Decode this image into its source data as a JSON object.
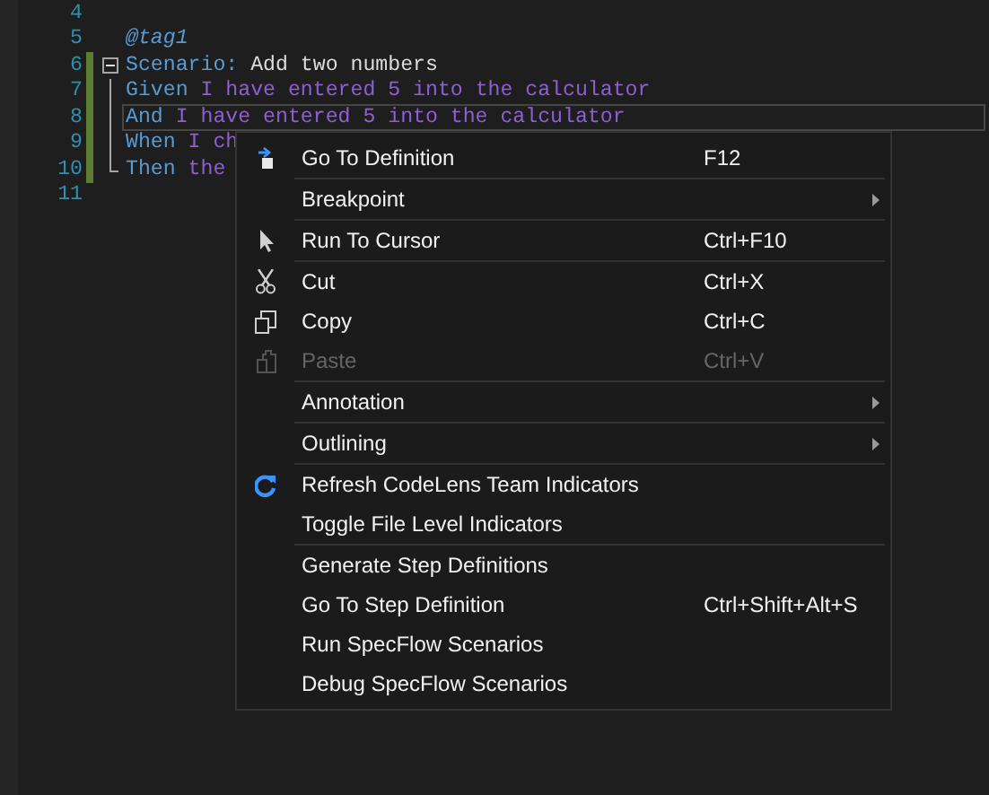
{
  "editor": {
    "lines": [
      {
        "number": "4"
      },
      {
        "number": "5",
        "tokens": [
          {
            "kind": "tag",
            "text": "@tag1"
          }
        ]
      },
      {
        "number": "6",
        "changed": true,
        "expanded": true,
        "tokens": [
          {
            "kind": "keyword",
            "text": "Scenario:"
          },
          {
            "kind": "plain",
            "text": " Add two numbers"
          }
        ]
      },
      {
        "number": "7",
        "changed": true,
        "tokens": [
          {
            "kind": "keyword",
            "text": "Given"
          },
          {
            "kind": "step",
            "text": " I have entered 5 into the calculator"
          }
        ]
      },
      {
        "number": "8",
        "changed": true,
        "current": true,
        "tokens": [
          {
            "kind": "keyword",
            "text": "And"
          },
          {
            "kind": "step",
            "text": " I have entered 5 into the calculator"
          }
        ]
      },
      {
        "number": "9",
        "changed": true,
        "tokens": [
          {
            "kind": "keyword",
            "text": "When"
          },
          {
            "kind": "step",
            "text": " I ch"
          }
        ]
      },
      {
        "number": "10",
        "changed": true,
        "tokens": [
          {
            "kind": "keyword",
            "text": "Then"
          },
          {
            "kind": "step",
            "text": " the"
          }
        ]
      },
      {
        "number": "11"
      }
    ]
  },
  "context_menu": {
    "items": [
      {
        "kind": "item",
        "label": "Go To Definition",
        "shortcut": "F12"
      },
      {
        "kind": "separator"
      },
      {
        "kind": "item",
        "label": "Breakpoint",
        "submenu": true
      },
      {
        "kind": "separator"
      },
      {
        "kind": "item",
        "label": "Run To Cursor",
        "shortcut": "Ctrl+F10"
      },
      {
        "kind": "separator"
      },
      {
        "kind": "item",
        "label": "Cut",
        "shortcut": "Ctrl+X"
      },
      {
        "kind": "item",
        "label": "Copy",
        "shortcut": "Ctrl+C"
      },
      {
        "kind": "item",
        "label": "Paste",
        "shortcut": "Ctrl+V",
        "disabled": true
      },
      {
        "kind": "separator"
      },
      {
        "kind": "item",
        "label": "Annotation",
        "submenu": true
      },
      {
        "kind": "separator"
      },
      {
        "kind": "item",
        "label": "Outlining",
        "submenu": true
      },
      {
        "kind": "separator"
      },
      {
        "kind": "item",
        "label": "Refresh CodeLens Team Indicators"
      },
      {
        "kind": "item",
        "label": "Toggle File Level Indicators"
      },
      {
        "kind": "separator"
      },
      {
        "kind": "item",
        "label": "Generate Step Definitions"
      },
      {
        "kind": "item",
        "label": "Go To Step Definition",
        "shortcut": "Ctrl+Shift+Alt+S"
      },
      {
        "kind": "item",
        "label": "Run SpecFlow Scenarios"
      },
      {
        "kind": "item",
        "label": "Debug SpecFlow Scenarios"
      }
    ]
  }
}
